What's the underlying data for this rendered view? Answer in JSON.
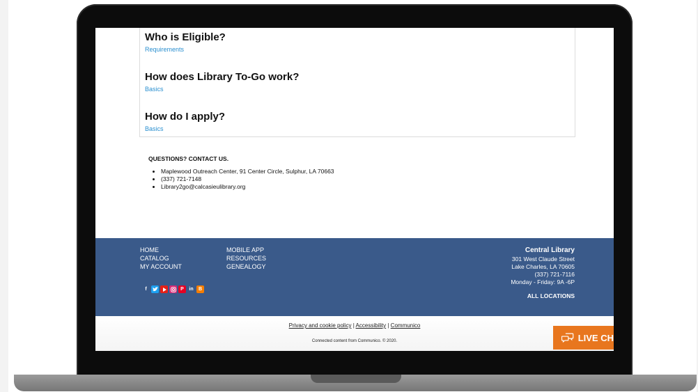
{
  "faq": [
    {
      "title": "Who is Eligible?",
      "link": "Requirements"
    },
    {
      "title": "How does Library To-Go work?",
      "link": "Basics"
    },
    {
      "title": "How do I apply?",
      "link": "Basics"
    }
  ],
  "contact": {
    "heading": "QUESTIONS? CONTACT US.",
    "items": [
      "Maplewood Outreach Center, 91 Center Circle, Sulphur, LA 70663",
      "(337) 721-7148",
      "Library2go@calcasieulibrary.org"
    ]
  },
  "footer": {
    "col1": [
      "HOME",
      "CATALOG",
      "MY ACCOUNT"
    ],
    "col2": [
      "MOBILE APP",
      "RESOURCES",
      "GENEALOGY"
    ],
    "social_icons": [
      "facebook-icon",
      "twitter-icon",
      "youtube-icon",
      "instagram-icon",
      "pinterest-icon",
      "linkedin-icon",
      "blogger-icon"
    ],
    "central": {
      "title": "Central Library",
      "address1": "301 West Claude Street",
      "address2": "Lake Charles, LA 70605",
      "phone": "(337) 721-7116",
      "hours": "Monday - Friday: 9A -6P",
      "all_locations": "ALL LOCATIONS"
    },
    "colors": {
      "bg": "#3a5a8a"
    }
  },
  "legal": {
    "privacy": "Privacy and cookie policy",
    "accessibility": "Accessibility",
    "communico": "Communico",
    "sep": "|",
    "copyright": "Connected content from Communico. © 2020."
  },
  "livechat": {
    "label": "LIVE CH",
    "color": "#e8761e"
  }
}
